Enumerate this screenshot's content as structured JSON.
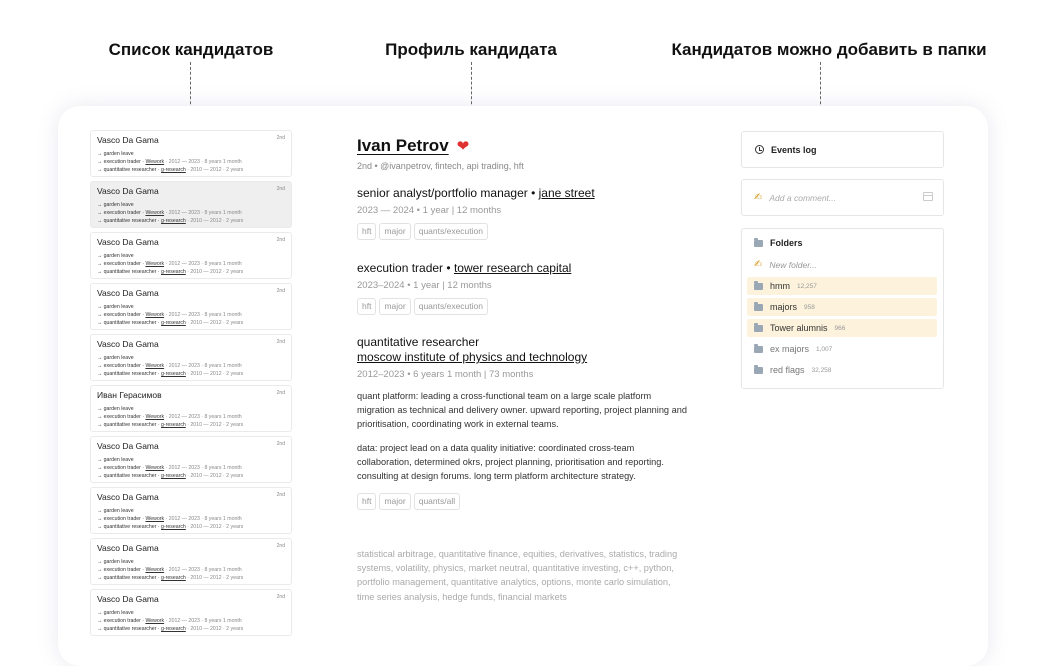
{
  "annotations": {
    "list": "Список кандидатов",
    "profile": "Профиль кандидата",
    "folders": "Кандидатов можно добавить в папки"
  },
  "candidates": [
    {
      "name": "Vasco Da Gama",
      "degree": "2nd",
      "l1": "→ garden leave",
      "l2a": "→ execution trader · ",
      "l2b": "Wework",
      "l2c": " · 2012 — 2023 · 8 years 1 month",
      "l3a": "→ quantitative researcher · ",
      "l3b": "g-research",
      "l3c": " · 2010 — 2012 · 2 years"
    },
    {
      "name": "Vasco Da Gama",
      "degree": "2nd",
      "l1": "→ garden leave",
      "l2a": "→ execution trader · ",
      "l2b": "Wework",
      "l2c": " · 2012 — 2023 · 8 years 1 month",
      "l3a": "→ quantitative researcher · ",
      "l3b": "g-research",
      "l3c": " · 2010 — 2012 · 2 years"
    },
    {
      "name": "Vasco Da Gama",
      "degree": "2nd",
      "l1": "→ garden leave",
      "l2a": "→ execution trader · ",
      "l2b": "Wework",
      "l2c": " · 2012 — 2023 · 8 years 1 month",
      "l3a": "→ quantitative researcher · ",
      "l3b": "g-research",
      "l3c": " · 2010 — 2012 · 2 years"
    },
    {
      "name": "Vasco Da Gama",
      "degree": "2nd",
      "l1": "→ garden leave",
      "l2a": "→ execution trader · ",
      "l2b": "Wework",
      "l2c": " · 2012 — 2023 · 8 years 1 month",
      "l3a": "→ quantitative researcher · ",
      "l3b": "g-research",
      "l3c": " · 2010 — 2012 · 2 years"
    },
    {
      "name": "Vasco Da Gama",
      "degree": "2nd",
      "l1": "→ garden leave",
      "l2a": "→ execution trader · ",
      "l2b": "Wework",
      "l2c": " · 2012 — 2023 · 8 years 1 month",
      "l3a": "→ quantitative researcher · ",
      "l3b": "g-research",
      "l3c": " · 2010 — 2012 · 2 years"
    },
    {
      "name": "Иван Герасимов",
      "degree": "2nd",
      "l1": "→ garden leave",
      "l2a": "→ execution trader · ",
      "l2b": "Wework",
      "l2c": " · 2012 — 2023 · 8 years 1 month",
      "l3a": "→ quantitative researcher · ",
      "l3b": "g-research",
      "l3c": " · 2010 — 2012 · 2 years"
    },
    {
      "name": "Vasco Da Gama",
      "degree": "2nd",
      "l1": "→ garden leave",
      "l2a": "→ execution trader · ",
      "l2b": "Wework",
      "l2c": " · 2012 — 2023 · 8 years 1 month",
      "l3a": "→ quantitative researcher · ",
      "l3b": "g-research",
      "l3c": " · 2010 — 2012 · 2 years"
    },
    {
      "name": "Vasco Da Gama",
      "degree": "2nd",
      "l1": "→ garden leave",
      "l2a": "→ execution trader · ",
      "l2b": "Wework",
      "l2c": " · 2012 — 2023 · 8 years 1 month",
      "l3a": "→ quantitative researcher · ",
      "l3b": "g-research",
      "l3c": " · 2010 — 2012 · 2 years"
    },
    {
      "name": "Vasco Da Gama",
      "degree": "2nd",
      "l1": "→ garden leave",
      "l2a": "→ execution trader · ",
      "l2b": "Wework",
      "l2c": " · 2012 — 2023 · 8 years 1 month",
      "l3a": "→ quantitative researcher · ",
      "l3b": "g-research",
      "l3c": " · 2010 — 2012 · 2 years"
    },
    {
      "name": "Vasco Da Gama",
      "degree": "2nd",
      "l1": "→ garden leave",
      "l2a": "→ execution trader · ",
      "l2b": "Wework",
      "l2c": " · 2012 — 2023 · 8 years 1 month",
      "l3a": "→ quantitative researcher · ",
      "l3b": "g-research",
      "l3c": " · 2010 — 2012 · 2 years"
    }
  ],
  "profile": {
    "name": "Ivan Petrov",
    "heart": "❤",
    "subtitle": "2nd • @ivanpetrov, fintech, api trading, hft",
    "jobs": [
      {
        "title": "senior analyst/portfolio manager",
        "sep": " • ",
        "company": "jane street",
        "dates": "2023 — 2024  • 1 year | 12 months",
        "tags": [
          "hft",
          "major",
          "quants/execution"
        ]
      },
      {
        "title": "execution trader",
        "sep": " • ",
        "company": "tower research capital",
        "dates": "2023–2024  • 1 year | 12 months",
        "tags": [
          "hft",
          "major",
          "quants/execution"
        ]
      },
      {
        "title": "quantitative researcher",
        "company": "moscow institute of physics and technology",
        "dates": "2012–2023  • 6 years 1 month | 73 months",
        "desc1": "quant platform: leading a cross-functional team on a large scale platform migration as technical and delivery owner. upward reporting, project planning and prioritisation, coordinating work in external teams.",
        "desc2": "data: project lead on a data quality initiative:  coordinated cross-team collaboration, determined okrs, project planning, prioritisation and reporting. consulting at design forums. long term platform architecture strategy.",
        "tags": [
          "hft",
          "major",
          "quants/all"
        ]
      }
    ],
    "skills": "statistical arbitrage, quantitative finance, equities, derivatives, statistics, trading systems, volatility, physics, market neutral, quantitative investing, c++, python, portfolio management, quantitative analytics, options, monte carlo simulation, time series analysis, hedge funds, financial markets"
  },
  "right": {
    "events_label": "Events log",
    "comment_placeholder": "Add a comment...",
    "folders_title": "Folders",
    "new_folder": "New folder...",
    "folders": [
      {
        "name": "hmm",
        "count": "12,257"
      },
      {
        "name": "majors",
        "count": "958"
      },
      {
        "name": "Tower alumnis",
        "count": "966"
      },
      {
        "name": "ex majors",
        "count": "1,007"
      },
      {
        "name": "red flags",
        "count": "32,258"
      }
    ]
  }
}
